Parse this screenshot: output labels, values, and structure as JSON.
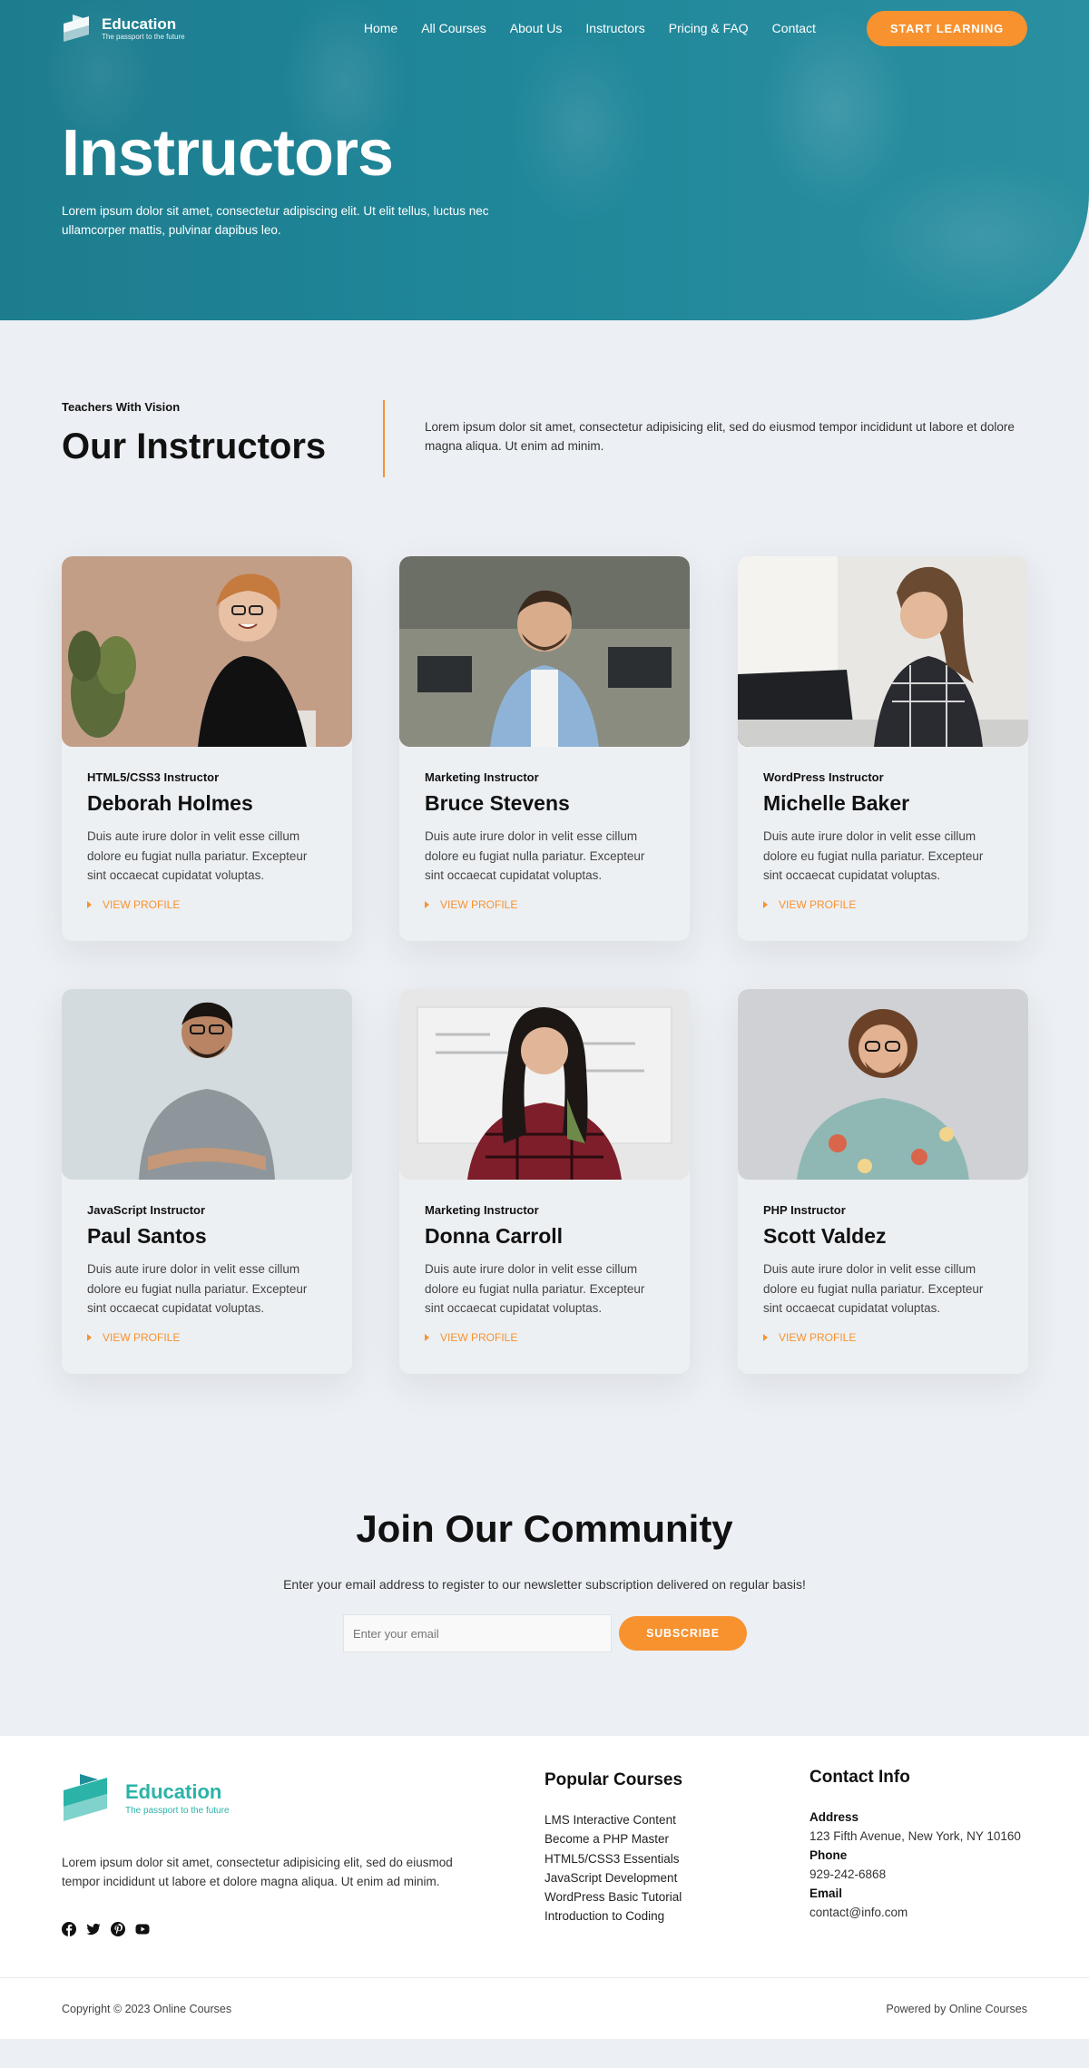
{
  "nav": {
    "logo_title": "Education",
    "logo_tagline": "The passport to the future",
    "items": [
      "Home",
      "All Courses",
      "About Us",
      "Instructors",
      "Pricing & FAQ",
      "Contact"
    ],
    "cta": "START LEARNING"
  },
  "hero": {
    "title": "Instructors",
    "subtitle": "Lorem ipsum dolor sit amet, consectetur adipiscing elit. Ut elit tellus, luctus nec ullamcorper mattis, pulvinar dapibus leo."
  },
  "intro": {
    "kicker": "Teachers With Vision",
    "title": "Our Instructors",
    "text": "Lorem ipsum dolor sit amet, consectetur adipisicing elit, sed do eiusmod tempor incididunt ut labore et dolore magna aliqua. Ut enim ad minim."
  },
  "instructors": [
    {
      "role": "HTML5/CSS3 Instructor",
      "name": "Deborah Holmes",
      "desc": "Duis aute irure dolor in velit esse cillum dolore eu fugiat nulla pariatur. Excepteur sint occaecat cupidatat voluptas.",
      "link": "VIEW PROFILE"
    },
    {
      "role": "Marketing Instructor",
      "name": "Bruce Stevens",
      "desc": "Duis aute irure dolor in velit esse cillum dolore eu fugiat nulla pariatur. Excepteur sint occaecat cupidatat voluptas.",
      "link": "VIEW PROFILE"
    },
    {
      "role": "WordPress Instructor",
      "name": "Michelle Baker",
      "desc": "Duis aute irure dolor in velit esse cillum dolore eu fugiat nulla pariatur. Excepteur sint occaecat cupidatat voluptas.",
      "link": "VIEW PROFILE"
    },
    {
      "role": "JavaScript Instructor",
      "name": "Paul Santos",
      "desc": "Duis aute irure dolor in velit esse cillum dolore eu fugiat nulla pariatur. Excepteur sint occaecat cupidatat voluptas.",
      "link": "VIEW PROFILE"
    },
    {
      "role": "Marketing Instructor",
      "name": "Donna Carroll",
      "desc": "Duis aute irure dolor in velit esse cillum dolore eu fugiat nulla pariatur. Excepteur sint occaecat cupidatat voluptas.",
      "link": "VIEW PROFILE"
    },
    {
      "role": "PHP Instructor",
      "name": "Scott Valdez",
      "desc": "Duis aute irure dolor in velit esse cillum dolore eu fugiat nulla pariatur. Excepteur sint occaecat cupidatat voluptas.",
      "link": "VIEW PROFILE"
    }
  ],
  "join": {
    "title": "Join Our Community",
    "subtitle": "Enter your email address to register to our newsletter subscription delivered on regular basis!",
    "placeholder": "Enter your email",
    "button": "SUBSCRIBE"
  },
  "footer": {
    "logo_title": "Education",
    "logo_tagline": "The passport to the future",
    "about": "Lorem ipsum dolor sit amet, consectetur adipisicing elit, sed do eiusmod tempor incididunt ut labore et dolore magna aliqua. Ut enim ad minim.",
    "social": [
      "facebook-icon",
      "twitter-icon",
      "pinterest-icon",
      "youtube-icon"
    ],
    "courses_title": "Popular Courses",
    "courses": [
      "LMS Interactive Content",
      "Become a PHP Master",
      "HTML5/CSS3 Essentials",
      "JavaScript Development",
      "WordPress Basic Tutorial",
      "Introduction to Coding"
    ],
    "contact_title": "Contact Info",
    "address_label": "Address",
    "address": "123 Fifth Avenue, New York, NY 10160",
    "phone_label": "Phone",
    "phone": "929-242-6868",
    "email_label": "Email",
    "email": "contact@info.com",
    "copyright": "Copyright © 2023 Online Courses",
    "powered": "Powered by Online Courses"
  },
  "colors": {
    "accent": "#f7922f",
    "hero": "#1f8699",
    "brand": "#2bb3a8"
  }
}
